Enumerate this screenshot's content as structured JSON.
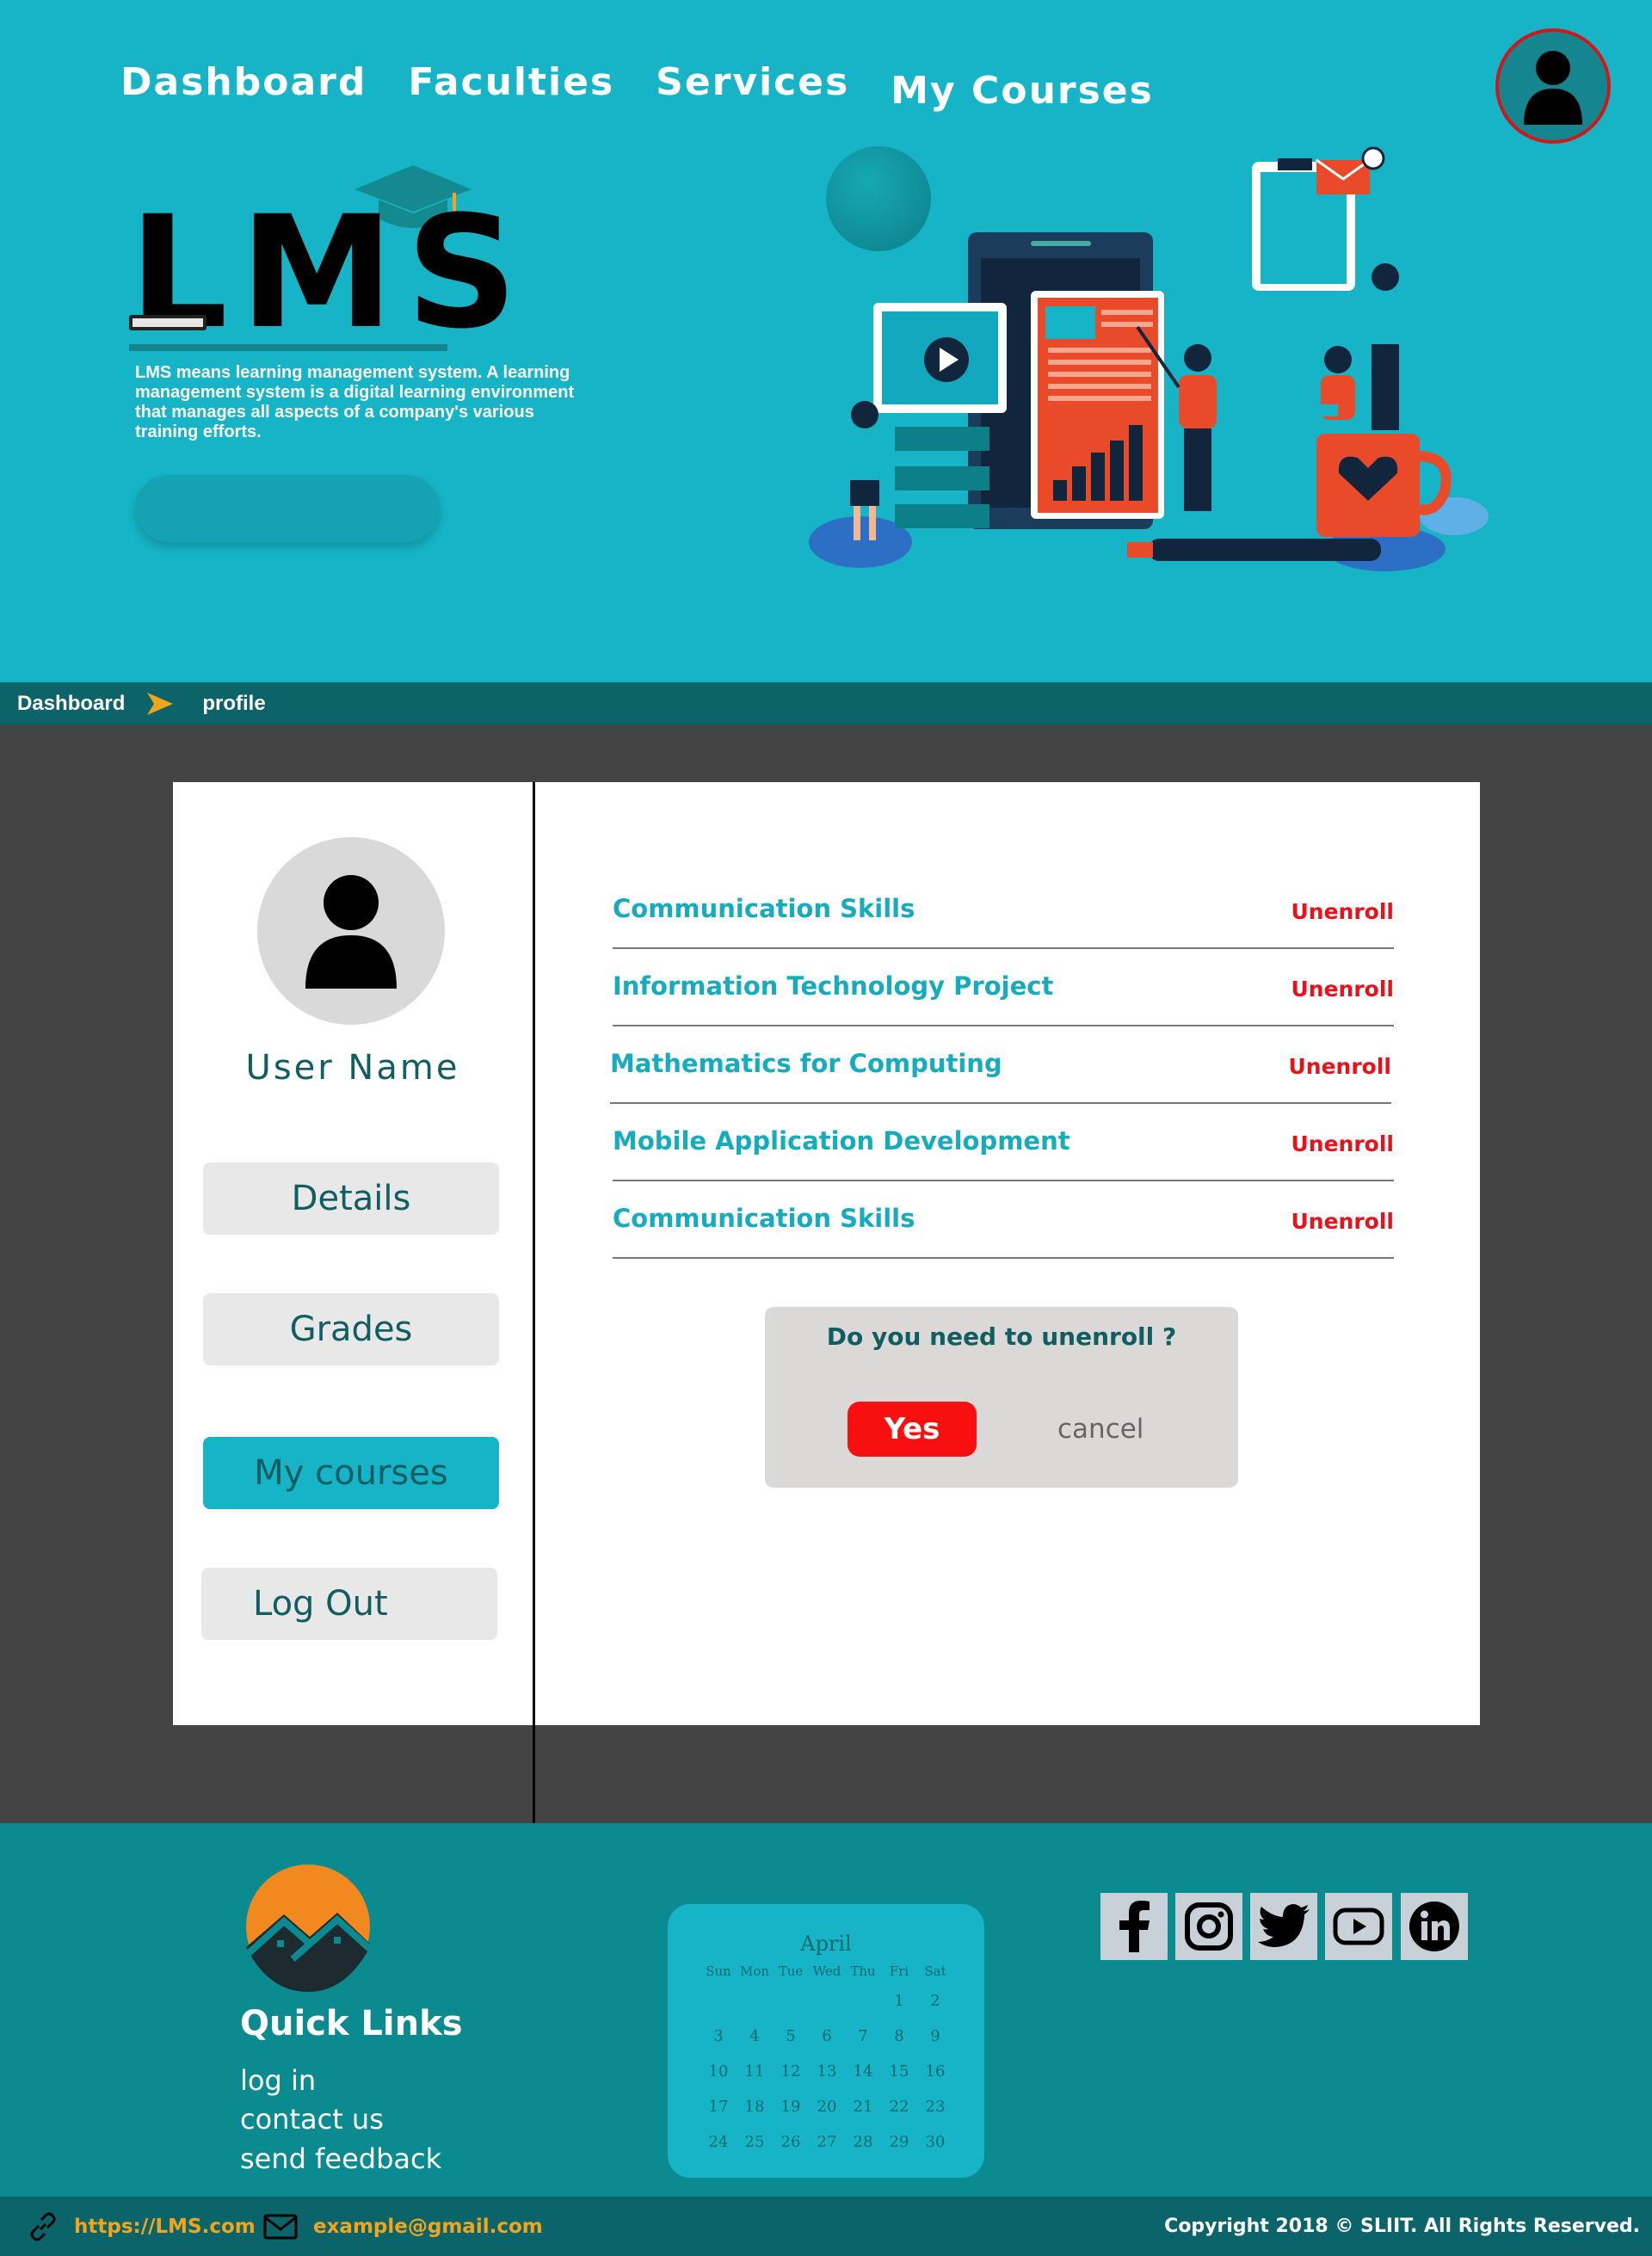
{
  "nav": {
    "items": [
      "Dashboard",
      "Faculties",
      "Services",
      "My Courses"
    ]
  },
  "hero": {
    "logo_text": "LMS",
    "intro": "LMS means learning management system. A learning management system is a digital learning environment that manages all aspects of a company's various training efforts."
  },
  "breadcrumb": {
    "home": "Dashboard",
    "current": "profile"
  },
  "profile": {
    "user_name": "User Name",
    "buttons": [
      "Details",
      "Grades",
      "My courses",
      "Log Out"
    ],
    "active_button": "My courses"
  },
  "courses": {
    "items": [
      "Communication Skills",
      "Information Technology Project",
      "Mathematics for Computing",
      "Mobile Application Development",
      "Communication Skills"
    ],
    "action_label": "Unenroll"
  },
  "dialog": {
    "question": "Do you need to unenroll ?",
    "yes_label": "Yes",
    "cancel_label": "cancel"
  },
  "footer": {
    "quick_links_title": "Quick Links",
    "quick_links": [
      "log in",
      "contact us",
      "send feedback"
    ],
    "calendar": {
      "month": "April",
      "weekdays": [
        "Sun",
        "Mon",
        "Tue",
        "Wed",
        "Thu",
        "Fri",
        "Sat"
      ],
      "weeks": [
        [
          "",
          "",
          "",
          "",
          "",
          "1",
          "2"
        ],
        [
          "3",
          "4",
          "5",
          "6",
          "7",
          "8",
          "9"
        ],
        [
          "10",
          "11",
          "12",
          "13",
          "14",
          "15",
          "16"
        ],
        [
          "17",
          "18",
          "19",
          "20",
          "21",
          "22",
          "23"
        ],
        [
          "24",
          "25",
          "26",
          "27",
          "28",
          "29",
          "30"
        ]
      ]
    },
    "social_icons": [
      "facebook-icon",
      "instagram-icon",
      "twitter-icon",
      "youtube-icon",
      "linkedin-icon"
    ],
    "website": "https://LMS.com",
    "email": "example@gmail.com",
    "copyright": "Copyright 2018 © SLIIT. All Rights Reserved."
  },
  "colors": {
    "primary": "#16b4c6",
    "dark_teal": "#0c6468",
    "footer": "#0b8a8f",
    "danger": "#e8121b",
    "text_teal": "#105e62"
  }
}
